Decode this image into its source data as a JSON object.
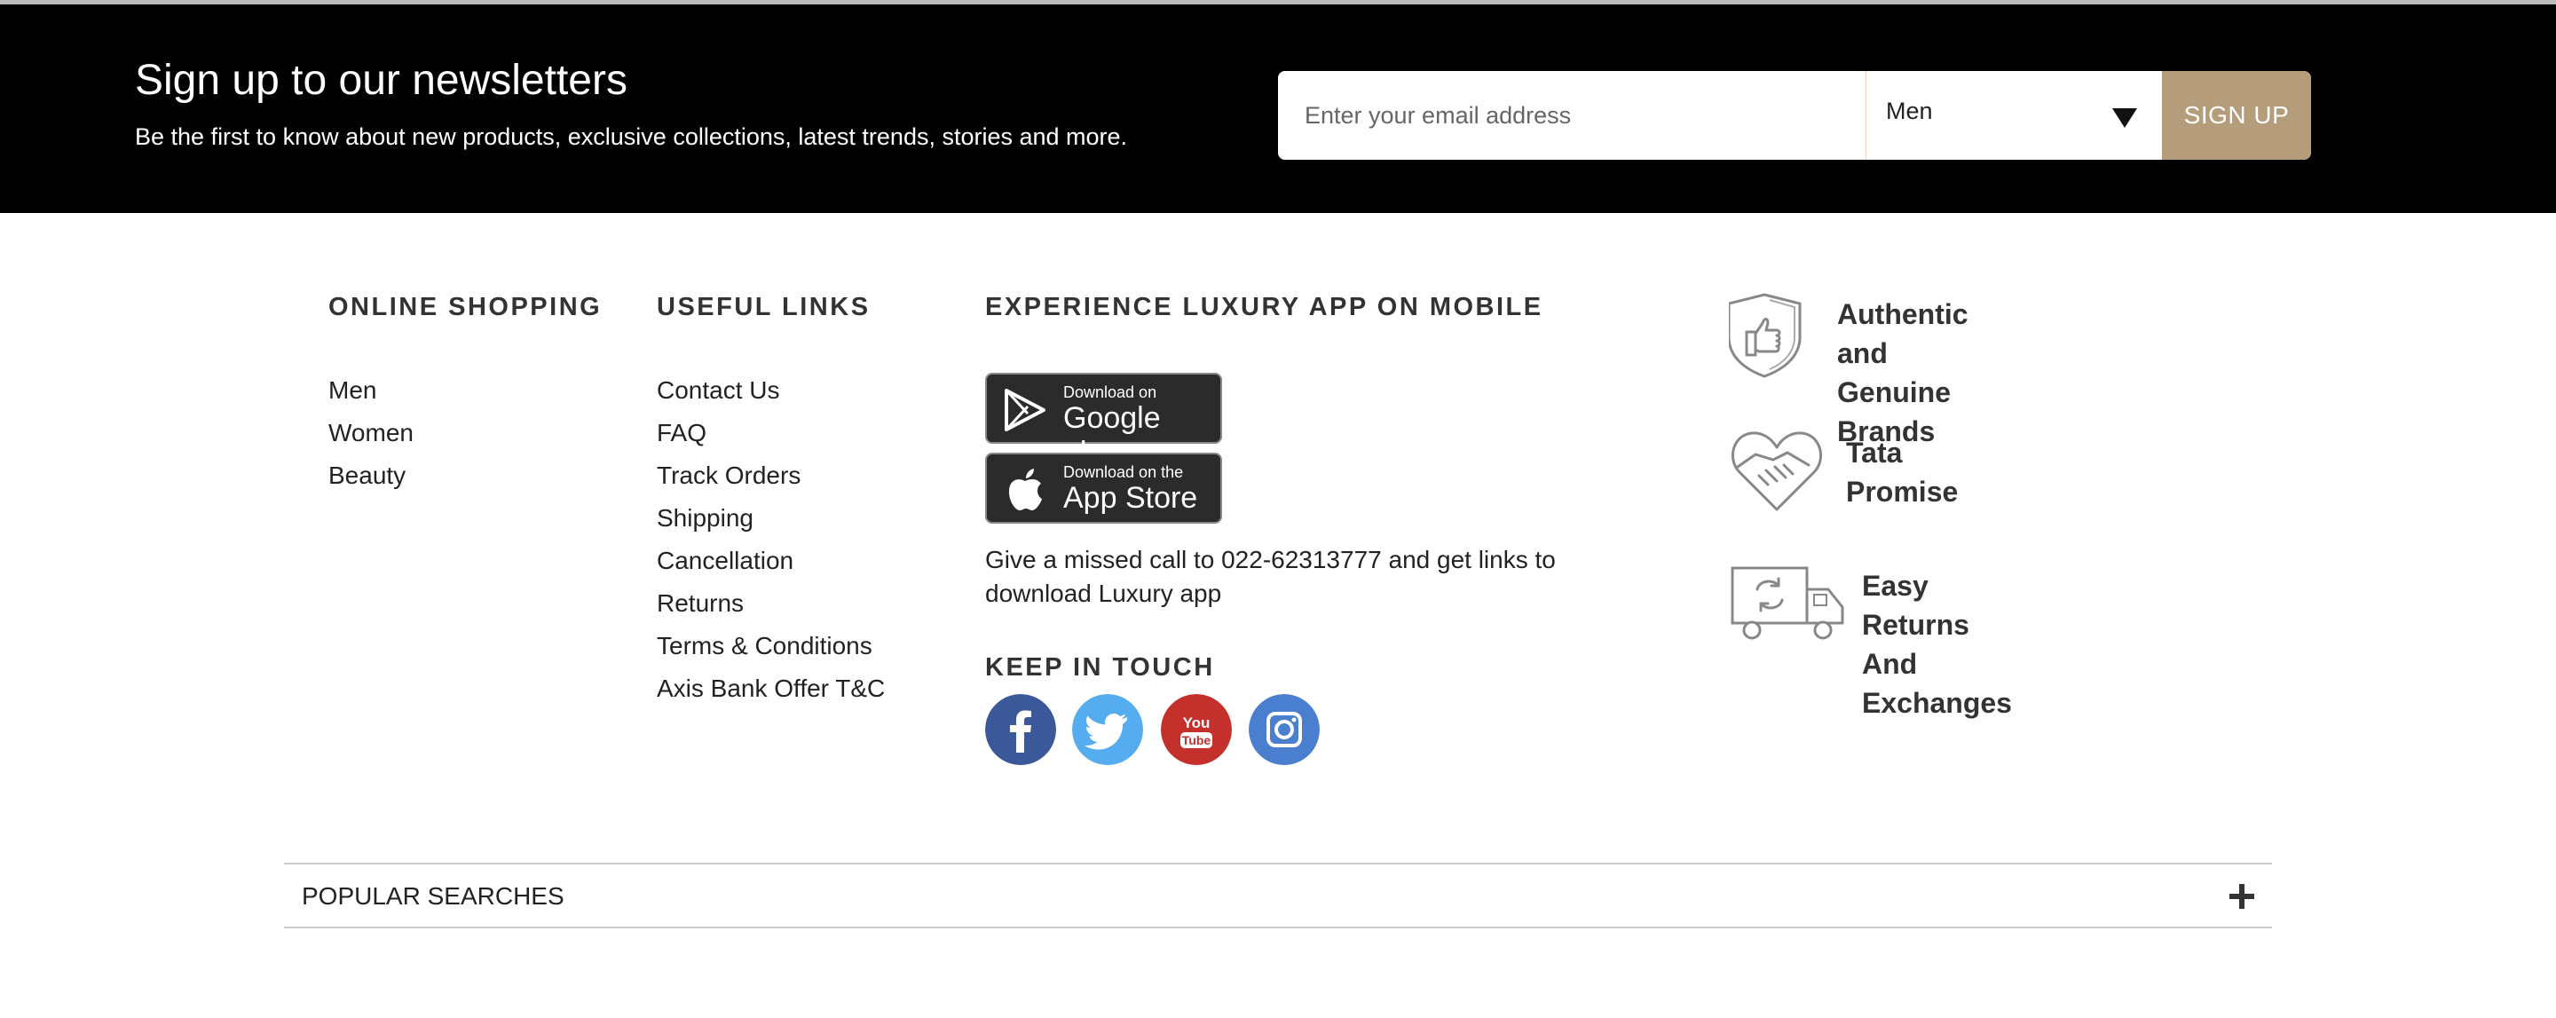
{
  "newsletter": {
    "title": "Sign up to our newsletters",
    "subtitle": "Be the first to know about new products, exclusive collections, latest trends, stories and more.",
    "email_placeholder": "Enter your email address",
    "email_value": "",
    "gender_selected": "Men",
    "signup_label": "SIGN UP",
    "accent_color": "#b59c7b"
  },
  "online_shopping": {
    "heading": "ONLINE SHOPPING",
    "items": [
      "Men",
      "Women",
      "Beauty"
    ]
  },
  "useful_links": {
    "heading": "USEFUL LINKS",
    "items": [
      "Contact Us",
      "FAQ",
      "Track Orders",
      "Shipping",
      "Cancellation",
      "Returns",
      "Terms & Conditions",
      "Axis Bank Offer T&C"
    ]
  },
  "app": {
    "heading": "EXPERIENCE LUXURY APP ON MOBILE",
    "google_play": {
      "small": "Download on",
      "big": "Google play",
      "icon": "google-play-icon"
    },
    "app_store": {
      "small": "Download on the",
      "big": "App Store",
      "icon": "apple-icon"
    },
    "missed_call_text": "Give a missed call to 022-62313777 and get links to download Luxury app"
  },
  "keep_in_touch": {
    "heading": "KEEP IN TOUCH",
    "socials": [
      {
        "name": "facebook",
        "color": "#3b5998"
      },
      {
        "name": "twitter",
        "color": "#55acee"
      },
      {
        "name": "youtube",
        "color": "#c4302b"
      },
      {
        "name": "instagram",
        "color": "#4a7fd0"
      }
    ]
  },
  "promises": [
    {
      "text": "Authentic and\nGenuine Brands",
      "icon": "shield-thumbs-up-icon"
    },
    {
      "text": "Tata Promise",
      "icon": "handshake-heart-icon"
    },
    {
      "text": "Easy Returns And\nExchanges",
      "icon": "delivery-truck-icon"
    }
  ],
  "popular_searches": {
    "label": "POPULAR SEARCHES",
    "icon": "plus-icon"
  }
}
